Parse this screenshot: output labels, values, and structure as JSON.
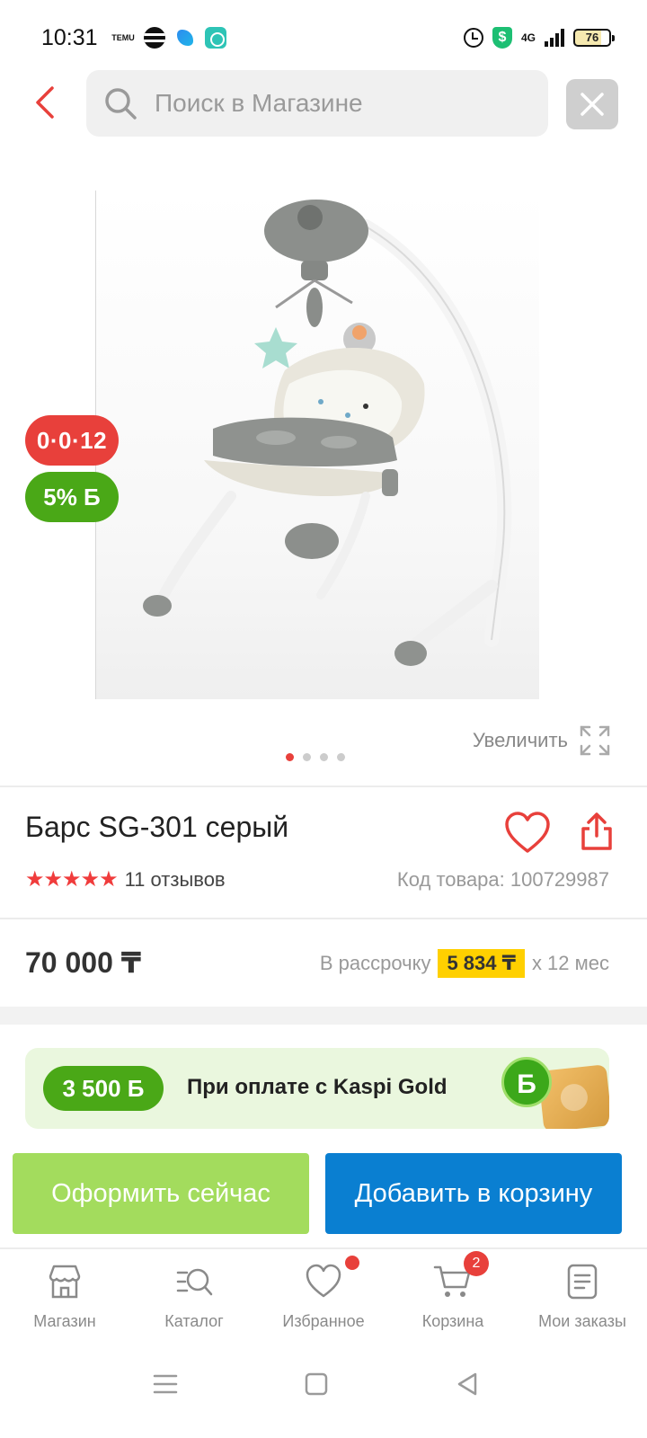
{
  "status_bar": {
    "time": "10:31",
    "app_icons": [
      "temu-icon",
      "stripe-circle-icon",
      "blue-app-icon",
      "teal-app-icon"
    ],
    "temu_text": "TEMU",
    "network": "4G",
    "battery": "76"
  },
  "header": {
    "search_placeholder": "Поиск в Магазине"
  },
  "product": {
    "badge_installment": "0·0·12",
    "badge_bonus": "5% Б",
    "zoom_label": "Увеличить",
    "image_count": 4,
    "active_image": 1,
    "title": "Барс SG-301 серый",
    "rating": 5,
    "reviews": "11 отзывов",
    "sku": "Код товара: 100729987",
    "price": "70 000 ₸",
    "installment_prefix": "В рассрочку",
    "installment_amount": "5 834 ₸",
    "installment_suffix": "x 12 мес"
  },
  "promo": {
    "bonus": "3 500 Б",
    "text": "При оплате с Kaspi Gold",
    "coin_letter": "Б"
  },
  "actions": {
    "checkout": "Оформить сейчас",
    "add_to_cart": "Добавить в корзину"
  },
  "bottom_nav": [
    {
      "label": "Магазин",
      "icon": "store-icon"
    },
    {
      "label": "Каталог",
      "icon": "catalog-icon"
    },
    {
      "label": "Избранное",
      "icon": "heart-icon"
    },
    {
      "label": "Корзина",
      "icon": "cart-icon"
    },
    {
      "label": "Мои заказы",
      "icon": "orders-icon"
    }
  ],
  "cart_count": "2",
  "colors": {
    "accent_red": "#e8403b",
    "bonus_green": "#4aa817",
    "checkout_green": "#a3dc5d",
    "cart_blue": "#0a7fd1",
    "installment_yellow": "#ffd000"
  }
}
